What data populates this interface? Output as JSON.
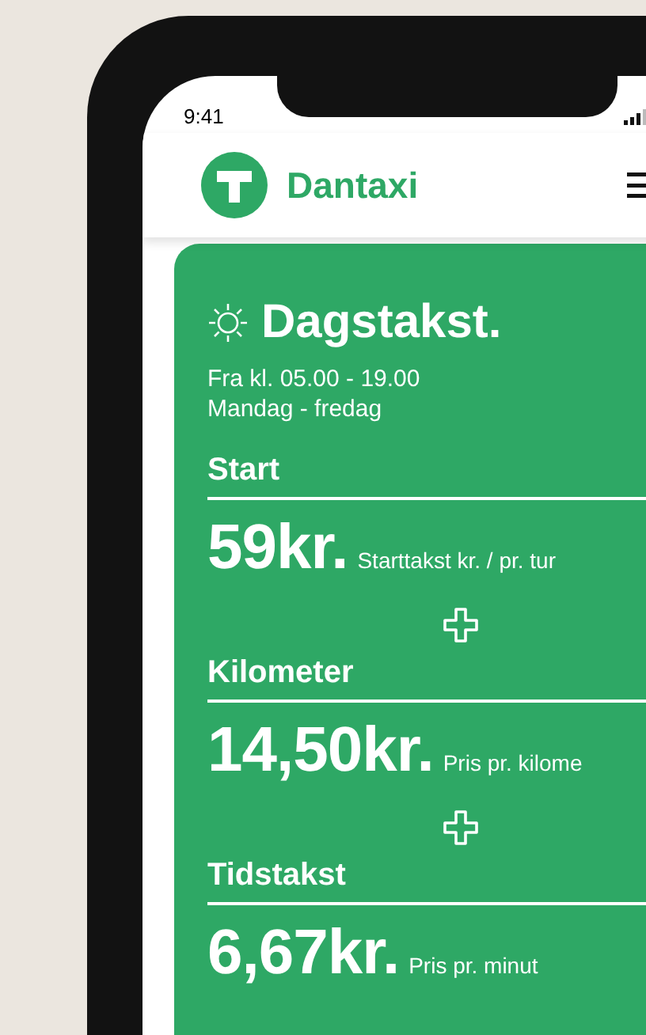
{
  "status_bar": {
    "time": "9:41"
  },
  "header": {
    "brand": "Dantaxi"
  },
  "tariff": {
    "title": "Dagstakst.",
    "hours": "Fra kl. 05.00 - 19.00",
    "days": "Mandag - fredag",
    "items": [
      {
        "label": "Start",
        "price": "59kr.",
        "note": "Starttakst kr. / pr. tur"
      },
      {
        "label": "Kilometer",
        "price": "14,50kr.",
        "note": "Pris pr. kilome"
      },
      {
        "label": "Tidstakst",
        "price": "6,67kr.",
        "note": "Pris pr. minut"
      }
    ]
  }
}
